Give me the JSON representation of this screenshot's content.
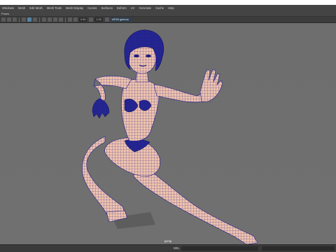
{
  "menubar": {
    "items": [
      "Windows",
      "Mesh",
      "Edit Mesh",
      "Mesh Tools",
      "Mesh Display",
      "Curves",
      "Surfaces",
      "Deform",
      "UV",
      "Generate",
      "Cache",
      "Help"
    ]
  },
  "shelf": {
    "label": "Poses"
  },
  "toolbar": {
    "field_a": "0.00",
    "field_b": "1.00",
    "color_space": "sRGB gamma"
  },
  "viewport": {
    "camera_label": "persp",
    "mesh_color": "#f0c3ad",
    "wire_color": "#1e1e8c",
    "background": "#6e6e6e"
  },
  "statusbar": {
    "mel_label": "MEL"
  }
}
